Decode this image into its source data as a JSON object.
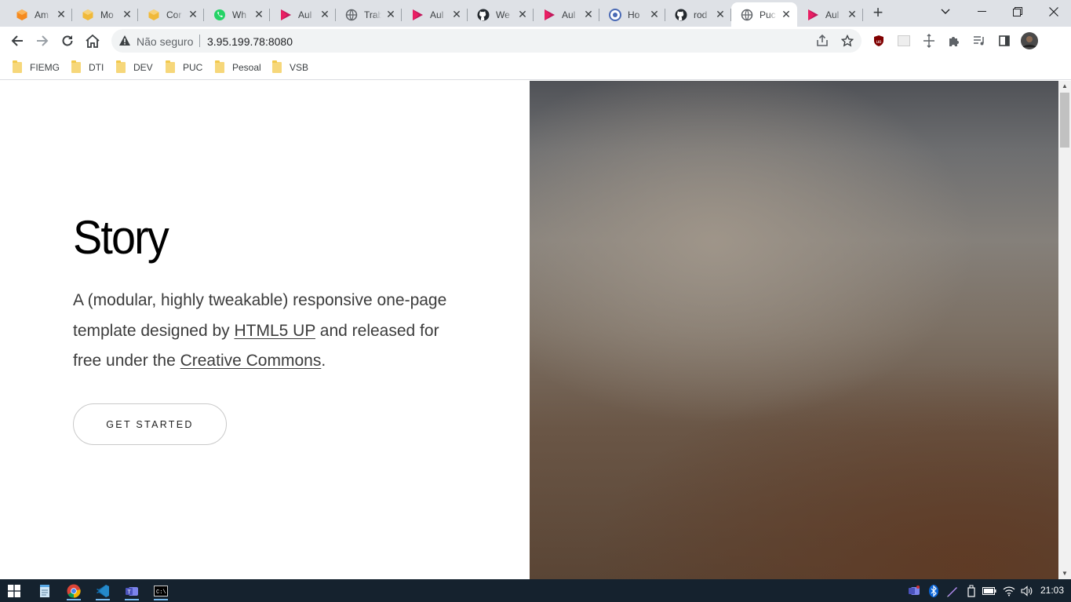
{
  "browser": {
    "tabs": [
      {
        "title": "Am",
        "icon": "cube-orange-icon"
      },
      {
        "title": "Mo",
        "icon": "cube-yellow-icon"
      },
      {
        "title": "Cor",
        "icon": "cube-yellow-icon"
      },
      {
        "title": "Wh",
        "icon": "whatsapp-icon"
      },
      {
        "title": "Aul",
        "icon": "play-red-icon"
      },
      {
        "title": "Trab",
        "icon": "globe-icon"
      },
      {
        "title": "Aul",
        "icon": "play-red-icon"
      },
      {
        "title": "We",
        "icon": "github-icon"
      },
      {
        "title": "Aul",
        "icon": "play-red-icon"
      },
      {
        "title": "Ho",
        "icon": "circle-blue-icon"
      },
      {
        "title": "rod",
        "icon": "github-icon"
      },
      {
        "title": "Puc",
        "icon": "globe-icon",
        "active": true
      },
      {
        "title": "Aul",
        "icon": "play-red-icon"
      }
    ],
    "security_label": "Não seguro",
    "url": "3.95.199.78:8080",
    "bookmarks": [
      "FIEMG",
      "DTI",
      "DEV",
      "PUC",
      "Pesoal",
      "VSB"
    ]
  },
  "page": {
    "title": "Story",
    "desc_before": "A (modular, highly tweakable) responsive one-page template designed by ",
    "link1": "HTML5 UP",
    "desc_middle": " and released for free under the ",
    "link2": "Creative Commons",
    "desc_after": ".",
    "cta": "GET STARTED"
  },
  "taskbar": {
    "clock": "21:03"
  },
  "colors": {
    "tabstrip": "#dee1e6",
    "taskbar": "#15222e",
    "accent_red": "#c2185b"
  }
}
